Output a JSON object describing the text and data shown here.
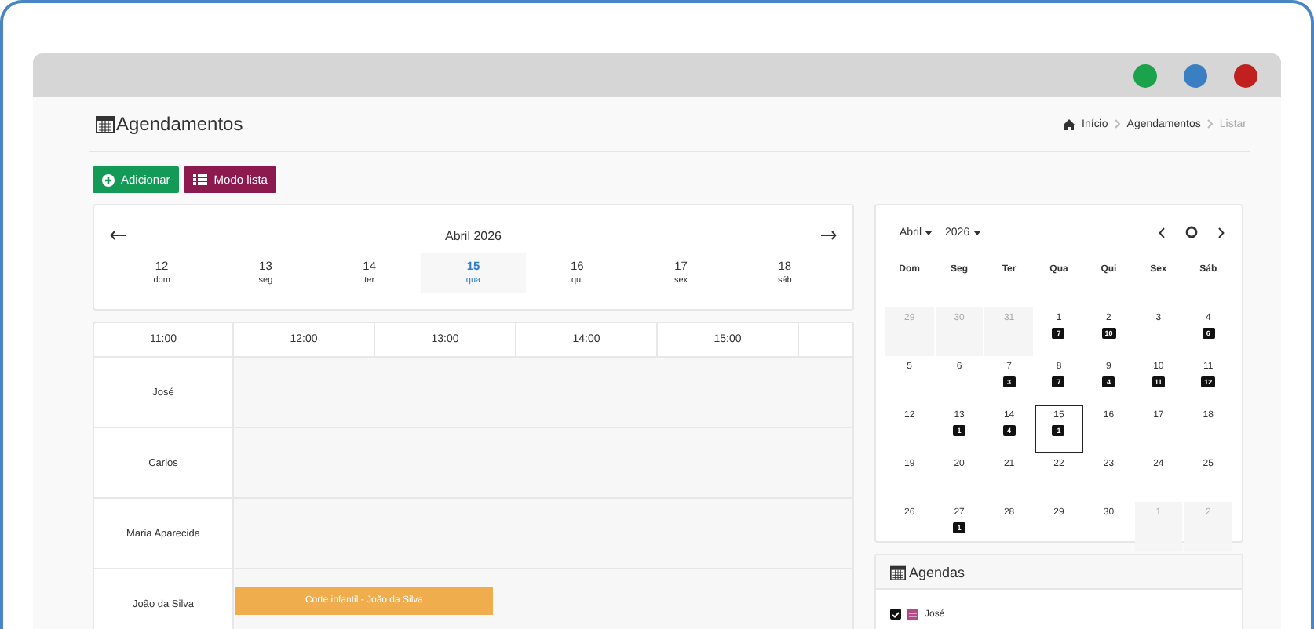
{
  "page": {
    "title": "Agendamentos"
  },
  "breadcrumb": [
    {
      "label": "Início",
      "current": false
    },
    {
      "label": "Agendamentos",
      "current": false
    },
    {
      "label": "Listar",
      "current": true
    }
  ],
  "buttons": [
    {
      "label": "Adicionar",
      "kind": "add"
    },
    {
      "label": "Modo lista",
      "kind": "list"
    }
  ],
  "day_strip": {
    "title": "Abril 2026",
    "days": [
      {
        "day": "12",
        "weekday": "dom",
        "selected": false
      },
      {
        "day": "13",
        "weekday": "seg",
        "selected": false
      },
      {
        "day": "14",
        "weekday": "ter",
        "selected": false
      },
      {
        "day": "15",
        "weekday": "qua",
        "selected": true
      },
      {
        "day": "16",
        "weekday": "qui",
        "selected": false
      },
      {
        "day": "17",
        "weekday": "sex",
        "selected": false
      },
      {
        "day": "18",
        "weekday": "sáb",
        "selected": false
      }
    ]
  },
  "timeline": {
    "hours": [
      "11:00",
      "12:00",
      "13:00",
      "14:00",
      "15:00"
    ],
    "rows": [
      {
        "name": "José",
        "events": []
      },
      {
        "name": "Carlos",
        "events": []
      },
      {
        "name": "Maria Aparecida",
        "events": []
      },
      {
        "name": "João da Silva",
        "events": [
          {
            "label": "Corte infantil - João da Silva",
            "color": "#f0ad4e"
          }
        ]
      }
    ]
  },
  "mini_calendar": {
    "month": "Abril",
    "year": "2026",
    "weekdays": [
      "Dom",
      "Seg",
      "Ter",
      "Qua",
      "Qui",
      "Sex",
      "Sáb"
    ],
    "weeks": [
      [
        {
          "day": "29",
          "muted": true
        },
        {
          "day": "30",
          "muted": true
        },
        {
          "day": "31",
          "muted": true
        },
        {
          "day": "1",
          "count": "7"
        },
        {
          "day": "2",
          "count": "10"
        },
        {
          "day": "3"
        },
        {
          "day": "4",
          "count": "6"
        }
      ],
      [
        {
          "day": "5"
        },
        {
          "day": "6"
        },
        {
          "day": "7",
          "count": "3"
        },
        {
          "day": "8",
          "count": "7"
        },
        {
          "day": "9",
          "count": "4"
        },
        {
          "day": "10",
          "count": "11"
        },
        {
          "day": "11",
          "count": "12"
        }
      ],
      [
        {
          "day": "12"
        },
        {
          "day": "13",
          "count": "1"
        },
        {
          "day": "14",
          "count": "4"
        },
        {
          "day": "15",
          "count": "1",
          "selected": true
        },
        {
          "day": "16"
        },
        {
          "day": "17"
        },
        {
          "day": "18"
        }
      ],
      [
        {
          "day": "19"
        },
        {
          "day": "20"
        },
        {
          "day": "21"
        },
        {
          "day": "22"
        },
        {
          "day": "23"
        },
        {
          "day": "24"
        },
        {
          "day": "25"
        }
      ],
      [
        {
          "day": "26"
        },
        {
          "day": "27",
          "count": "1"
        },
        {
          "day": "28"
        },
        {
          "day": "29"
        },
        {
          "day": "30"
        },
        {
          "day": "1",
          "muted": true
        },
        {
          "day": "2",
          "muted": true
        }
      ]
    ]
  },
  "agendas": {
    "title": "Agendas",
    "items": [
      {
        "label": "José",
        "checked": true
      }
    ]
  }
}
